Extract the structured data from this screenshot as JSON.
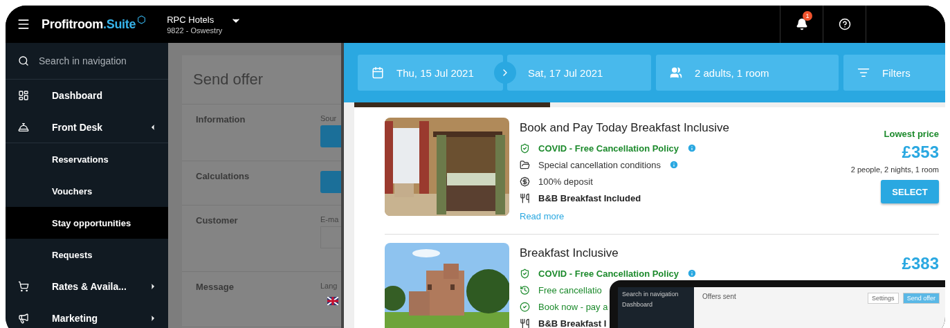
{
  "topbar": {
    "logo": {
      "name": "Profitroom",
      "suffix": ".Suite"
    },
    "hotel": {
      "name": "RPC Hotels",
      "code": "9822 - Oswestry"
    },
    "notification_count": "1"
  },
  "sidebar": {
    "search_placeholder": "Search in navigation",
    "items": [
      {
        "kind": "link",
        "label": "Dashboard"
      },
      {
        "kind": "group",
        "label": "Front Desk",
        "expanded": true,
        "children": [
          {
            "label": "Reservations",
            "selected": false
          },
          {
            "label": "Vouchers",
            "selected": false
          },
          {
            "label": "Stay opportunities",
            "selected": true
          },
          {
            "label": "Requests",
            "selected": false
          }
        ]
      },
      {
        "kind": "group",
        "label": "Rates & Availa...",
        "expanded": false
      },
      {
        "kind": "group",
        "label": "Marketing",
        "expanded": false
      }
    ]
  },
  "background_page": {
    "title": "Send offer",
    "sections": [
      {
        "label": "Information",
        "field_label": "Sour",
        "kind": "button"
      },
      {
        "label": "Calculations",
        "kind": "button"
      },
      {
        "label": "Customer",
        "field_label": "E-ma",
        "kind": "input"
      },
      {
        "label": "Message",
        "field_label": "Lang",
        "kind": "flag"
      }
    ]
  },
  "booking": {
    "search": {
      "check_in": "Thu, 15 Jul 2021",
      "check_out": "Sat, 17 Jul 2021",
      "guests": "2 adults, 1 room",
      "filters": "Filters"
    },
    "offers": [
      {
        "title": "Book and Pay Today Breakfast Inclusive",
        "features": [
          {
            "kind": "covid",
            "text": "COVID - Free Cancellation Policy",
            "info": true
          },
          {
            "kind": "conditions",
            "text": "Special cancellation conditions",
            "info": true
          },
          {
            "kind": "deposit",
            "text": "100% deposit",
            "info": false
          },
          {
            "kind": "meal",
            "text": "B&B Breakfast Included",
            "info": false
          }
        ],
        "read_more": "Read more",
        "price_label": "Lowest price",
        "price": "£353",
        "price_note": "2 people, 2 nights, 1 room",
        "button": "SELECT"
      },
      {
        "title": "Breakfast Inclusive",
        "features": [
          {
            "kind": "covid",
            "text": "COVID - Free Cancellation Policy",
            "info": true
          },
          {
            "kind": "free_cancel",
            "text": "Free cancellatio"
          },
          {
            "kind": "pay_later",
            "text": "Book now - pay a"
          },
          {
            "kind": "meal",
            "text": "B&B Breakfast I"
          }
        ],
        "price": "£383"
      }
    ]
  },
  "device": {
    "nav": [
      "Search in navigation",
      "Dashboard"
    ],
    "title": "Offers sent",
    "buttons": [
      "Settings",
      "Send offer"
    ]
  }
}
